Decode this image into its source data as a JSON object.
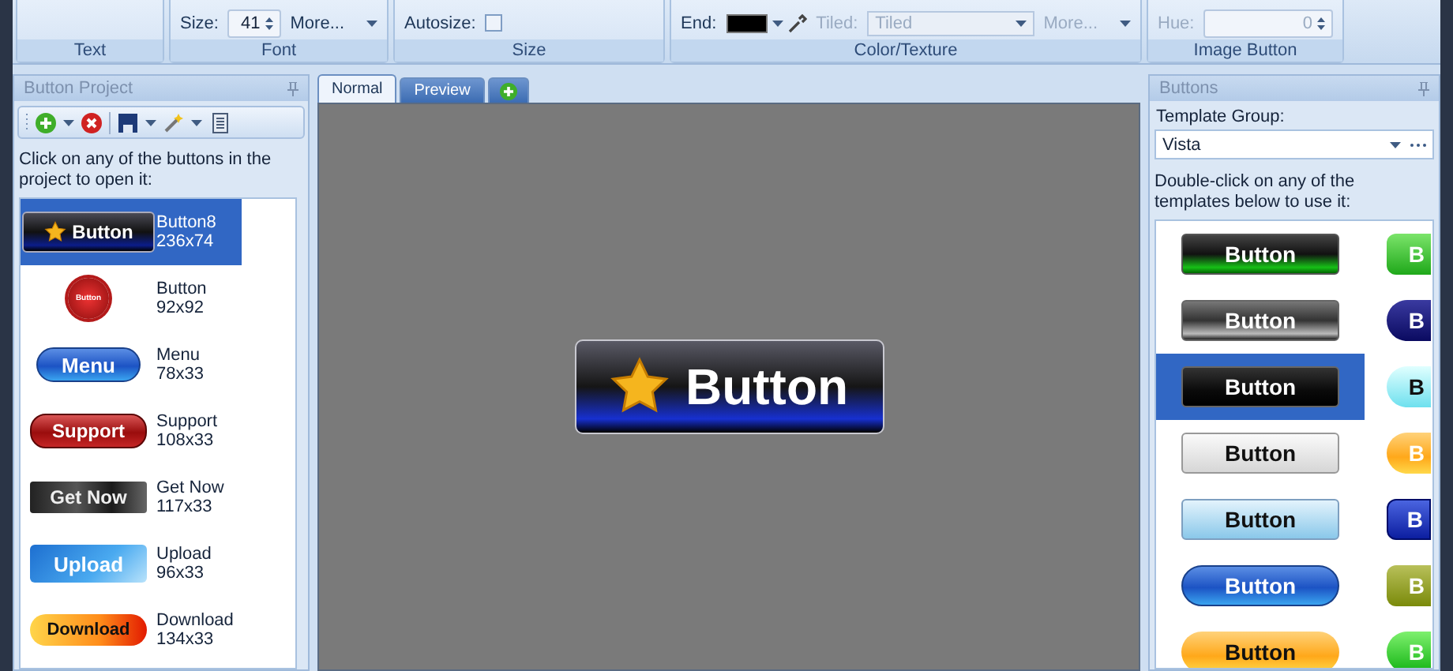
{
  "ribbon": {
    "groups": [
      {
        "label": "Text"
      },
      {
        "label": "Font",
        "controls": [
          {
            "kind": "spinner",
            "label": "Size:",
            "value": "41",
            "disabled": false
          },
          {
            "kind": "menu",
            "label": "More...",
            "disabled": false
          }
        ]
      },
      {
        "label": "Size",
        "controls": [
          {
            "kind": "checkbox",
            "label": "Autosize:",
            "checked": false,
            "disabled": false
          }
        ]
      },
      {
        "label": "Color/Texture",
        "controls": [
          {
            "kind": "color",
            "label": "End:",
            "color": "#000000",
            "disabled": false
          },
          {
            "kind": "dropdown",
            "label": "Tiled:",
            "value": "Tiled",
            "disabled": true
          },
          {
            "kind": "menu",
            "label": "More...",
            "disabled": true
          }
        ]
      },
      {
        "label": "Image Button",
        "controls": [
          {
            "kind": "spinner",
            "label": "Hue:",
            "value": "0",
            "disabled": true
          }
        ]
      }
    ]
  },
  "project_panel": {
    "title": "Button Project",
    "hint": "Click on any of the buttons in the project to open it:",
    "items": [
      {
        "kind": "star-dark",
        "preview": "Button",
        "name": "Button8",
        "size": "236x74",
        "selected": true
      },
      {
        "kind": "red-seal",
        "preview": "Button",
        "name": "Button",
        "size": "92x92",
        "selected": false
      },
      {
        "kind": "blue-pill",
        "preview": "Menu",
        "name": "Menu",
        "size": "78x33",
        "selected": false
      },
      {
        "kind": "red-pill",
        "preview": "Support",
        "name": "Support",
        "size": "108x33",
        "selected": false
      },
      {
        "kind": "grunge",
        "preview": "Get Now",
        "name": "Get Now",
        "size": "117x33",
        "selected": false
      },
      {
        "kind": "blue-glass",
        "preview": "Upload",
        "name": "Upload",
        "size": "96x33",
        "selected": false
      },
      {
        "kind": "orange-red",
        "preview": "Download",
        "name": "Download",
        "size": "134x33",
        "selected": false
      }
    ]
  },
  "editor": {
    "tabs": [
      {
        "kind": "text",
        "label": "Normal",
        "selected": true
      },
      {
        "kind": "text",
        "label": "Preview",
        "selected": false
      },
      {
        "kind": "add",
        "selected": false
      }
    ],
    "canvas_button": {
      "kind": "star-dark",
      "label": "Button"
    }
  },
  "templates_panel": {
    "title": "Buttons",
    "group_label": "Template Group:",
    "group_value": "Vista",
    "hint": "Double-click on any of the templates below to use it:",
    "rows": [
      {
        "left": {
          "kind": "green-glass",
          "label": "Button",
          "selected": false
        },
        "right": {
          "kind": "green",
          "label": "B",
          "selected": false
        }
      },
      {
        "left": {
          "kind": "gray-glass",
          "label": "Button",
          "selected": false
        },
        "right": {
          "kind": "navy-pill",
          "label": "B",
          "selected": false
        }
      },
      {
        "left": {
          "kind": "black-glass",
          "label": "Button",
          "selected": true
        },
        "right": {
          "kind": "cyan-pill",
          "label": "B",
          "selected": false
        }
      },
      {
        "left": {
          "kind": "silver",
          "label": "Button",
          "selected": false
        },
        "right": {
          "kind": "orange-pill",
          "label": "B",
          "selected": false
        }
      },
      {
        "left": {
          "kind": "light-blue",
          "label": "Button",
          "selected": false
        },
        "right": {
          "kind": "blue-dark",
          "label": "B",
          "selected": false
        }
      },
      {
        "left": {
          "kind": "blue-pill",
          "label": "Button",
          "selected": false
        },
        "right": {
          "kind": "olive",
          "label": "B",
          "selected": false
        }
      },
      {
        "left": {
          "kind": "orange-pill",
          "label": "Button",
          "selected": false
        },
        "right": {
          "kind": "green-pill",
          "label": "B",
          "selected": false
        }
      }
    ]
  }
}
